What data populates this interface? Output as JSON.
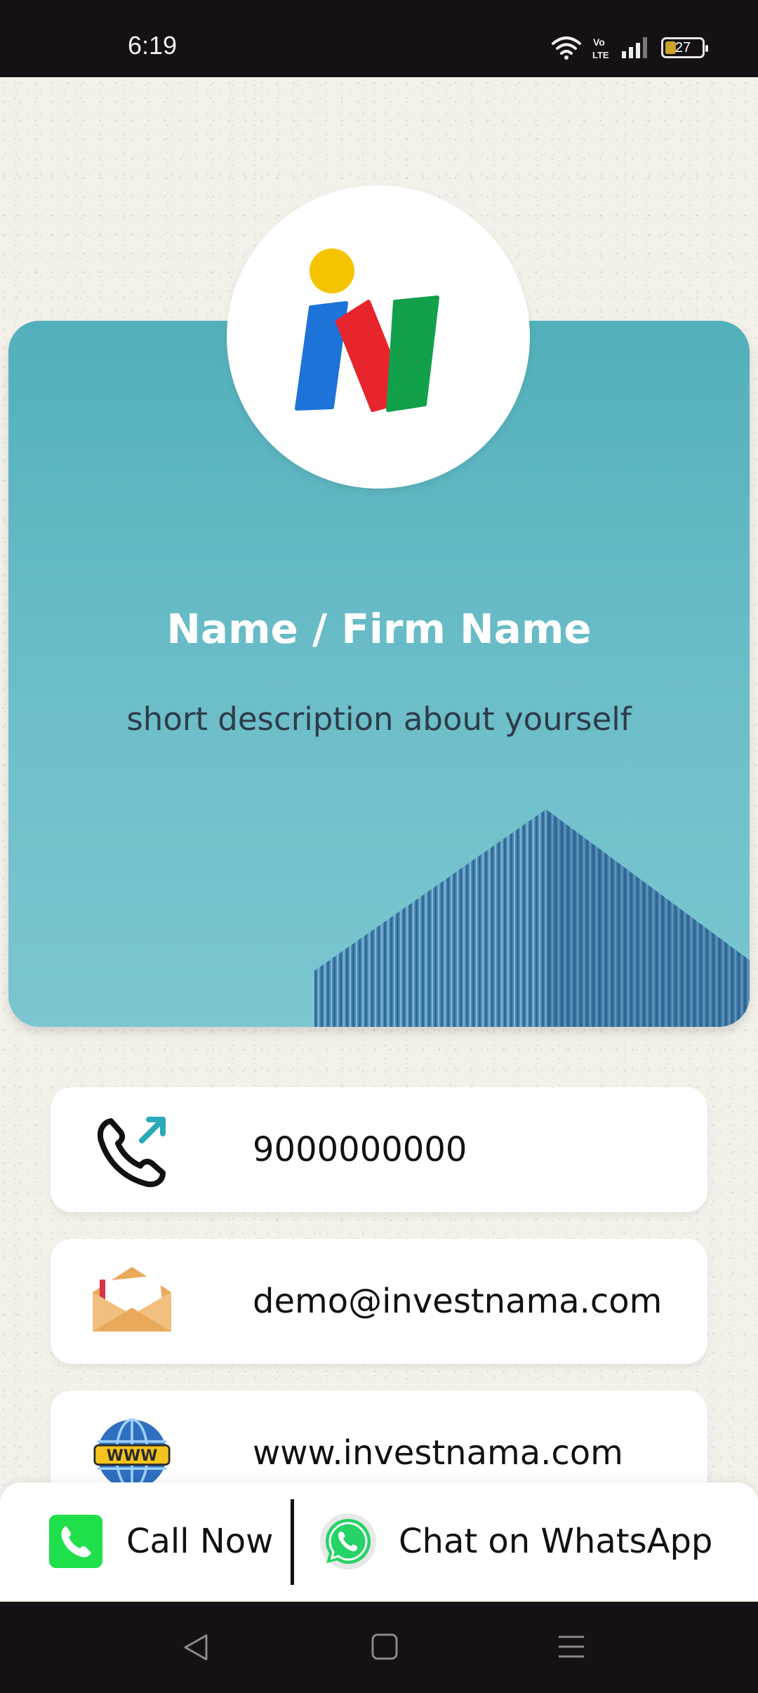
{
  "status_bar": {
    "time": "6:19",
    "battery_level": "27",
    "icons": [
      "wifi-icon",
      "volte-icon",
      "signal-icon",
      "battery-icon"
    ]
  },
  "logo": {
    "icon": "investnama-logo-icon",
    "colors": [
      "#f5c400",
      "#1e73d8",
      "#e8242c",
      "#12a04a"
    ]
  },
  "hero": {
    "title": "Name / Firm Name",
    "description": "short description about yourself",
    "background_color": "#5fb7c2"
  },
  "contacts": {
    "phone": {
      "icon": "phone-outgoing-icon",
      "value": "9000000000"
    },
    "email": {
      "icon": "envelope-icon",
      "value": "demo@investnama.com"
    },
    "website": {
      "icon": "globe-www-icon",
      "value": "www.investnama.com"
    }
  },
  "actions": {
    "call_label": "Call Now",
    "whatsapp_label": "Chat on WhatsApp",
    "call_color": "#1fe04a",
    "whatsapp_color": "#25d366"
  },
  "nav": {
    "buttons": [
      "back-icon",
      "home-icon",
      "recents-icon"
    ]
  }
}
